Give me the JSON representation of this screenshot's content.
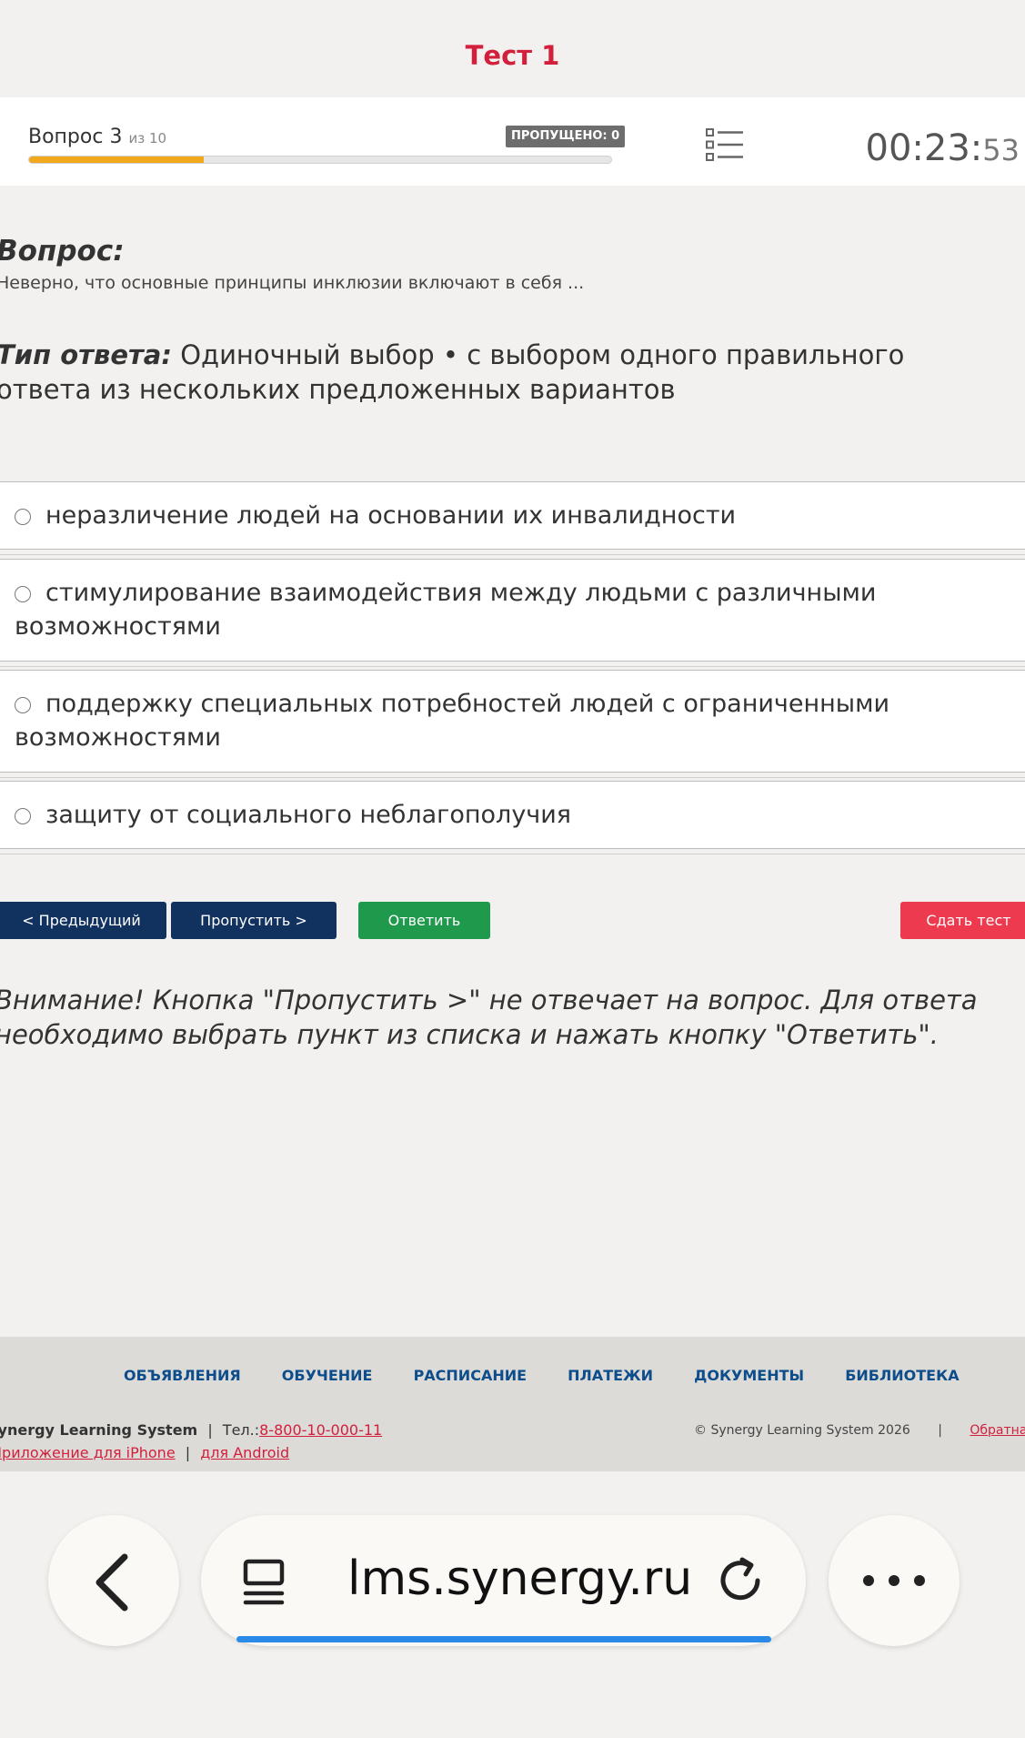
{
  "test": {
    "title": "Тест 1"
  },
  "header": {
    "question_word": "Вопрос",
    "question_number": "3",
    "question_of": "из 10",
    "skipped_badge": "ПРОПУЩЕНО: 0",
    "progress_fraction": 0.3,
    "timer_main": "00:23:",
    "timer_seconds": "53",
    "list_icon": "list-icon"
  },
  "question": {
    "label": "Вопрос:",
    "text": "Неверно, что основные принципы инклюзии включают в себя ...",
    "answer_type_label": "Тип ответа:",
    "answer_type_text": "Одиночный выбор • с выбором одного правильного ответа из нескольких предложенных вариантов"
  },
  "options": [
    "неразличение людей на основании их инвалидности",
    "стимулирование взаимодействия между людьми с различными возможностями",
    "поддержку специальных потребностей людей с ограниченными возможностями",
    "защиту от социального неблагополучия"
  ],
  "buttons": {
    "prev": "< Предыдущий",
    "skip": "Пропустить >",
    "answer": "Ответить",
    "submit": "Сдать тест"
  },
  "warning": "Внимание! Кнопка \"Пропустить >\" не отвечает на вопрос. Для ответа необходимо выбрать пункт из списка и нажать кнопку \"Ответить\".",
  "footer": {
    "nav": [
      "ОБЪЯВЛЕНИЯ",
      "ОБУЧЕНИЕ",
      "РАСПИСАНИЕ",
      "ПЛАТЕЖИ",
      "ДОКУМЕНТЫ",
      "БИБЛИОТЕКА"
    ],
    "system_name": "Synergy Learning System",
    "phone_label": "Тел.:",
    "phone": "8-800-10-000-11",
    "app_iphone": "Приложение для iPhone",
    "app_android": "для Android",
    "copyright": "© Synergy Learning System 2026",
    "separator": "|",
    "feedback": "Обратная связь"
  },
  "browser": {
    "url": "lms.synergy.ru",
    "back_icon": "back-icon",
    "tabs_icon": "tabs-icon",
    "reload_icon": "reload-icon",
    "more_icon": "more-icon",
    "load_fraction": 0.88,
    "accent": "#2b8ae8"
  },
  "colors": {
    "title": "#d21f3c",
    "primary_button": "#11315f",
    "answer_button": "#1f9a4c",
    "submit_button": "#ee3a4e",
    "progress": "#f2a81d",
    "nav_link": "#0e4d8c"
  }
}
